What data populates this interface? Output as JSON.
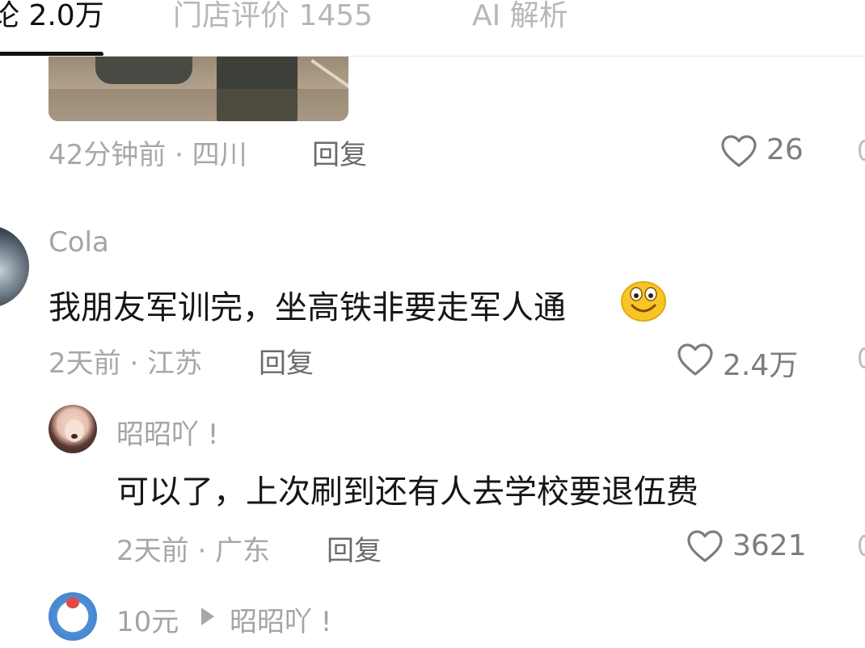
{
  "tabs": [
    {
      "label": "论 2.0万"
    },
    {
      "label": "门店评价 1455"
    },
    {
      "label": "AI 解析"
    }
  ],
  "comments": [
    {
      "meta": "42分钟前 · 四川",
      "reply_label": "回复",
      "like_count": "26"
    },
    {
      "username": "Cola",
      "content": "我朋友军训完，坐高铁非要走军人通",
      "meta": "2天前 · 江苏",
      "reply_label": "回复",
      "like_count": "2.4万"
    }
  ],
  "replies": [
    {
      "username": "昭昭吖 !",
      "content": "可以了，上次刷到还有人去学校要退伍费",
      "meta": "2天前 · 广东",
      "reply_label": "回复",
      "like_count": "3621"
    },
    {
      "username": "10元",
      "reply_to": "昭昭吖 !"
    }
  ],
  "icons": {
    "like": "heart-outline-icon",
    "emoji": "grinning-face-emoji",
    "reply_arrow": "play-triangle-icon"
  },
  "colors": {
    "text_primary": "#161616",
    "text_secondary": "#a8a8a8",
    "reply": "#6b6b6b",
    "tab_active": "#111111",
    "tab_inactive": "#b7b7b7"
  }
}
